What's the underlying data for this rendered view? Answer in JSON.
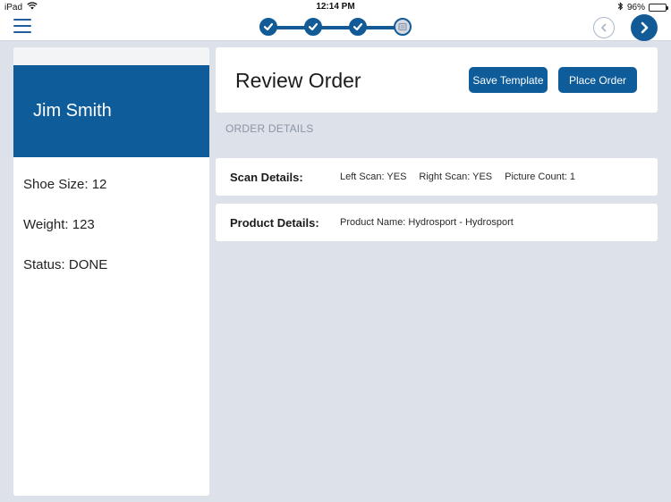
{
  "status_bar": {
    "device": "iPad",
    "time": "12:14 PM",
    "battery": "96%"
  },
  "nav": {
    "progress_steps": [
      {
        "state": "done"
      },
      {
        "state": "done"
      },
      {
        "state": "done"
      },
      {
        "state": "current"
      }
    ]
  },
  "customer": {
    "name": "Jim Smith",
    "shoe_size": "Shoe Size: 12",
    "weight": "Weight: 123",
    "status": "Status: DONE"
  },
  "header": {
    "title": "Review Order",
    "save_template_label": "Save Template",
    "place_order_label": "Place Order"
  },
  "order_details_label": "ORDER DETAILS",
  "scan_details": {
    "label": "Scan Details:",
    "left_scan": "Left Scan: YES",
    "right_scan": "Right Scan: YES",
    "picture_count": "Picture Count: 1"
  },
  "product_details": {
    "label": "Product Details:",
    "product_name": "Product Name: Hydrosport - Hydrosport"
  },
  "colors": {
    "primary": "#0e5c9a",
    "background": "#dde1ea",
    "muted_label": "#8a95a5"
  }
}
